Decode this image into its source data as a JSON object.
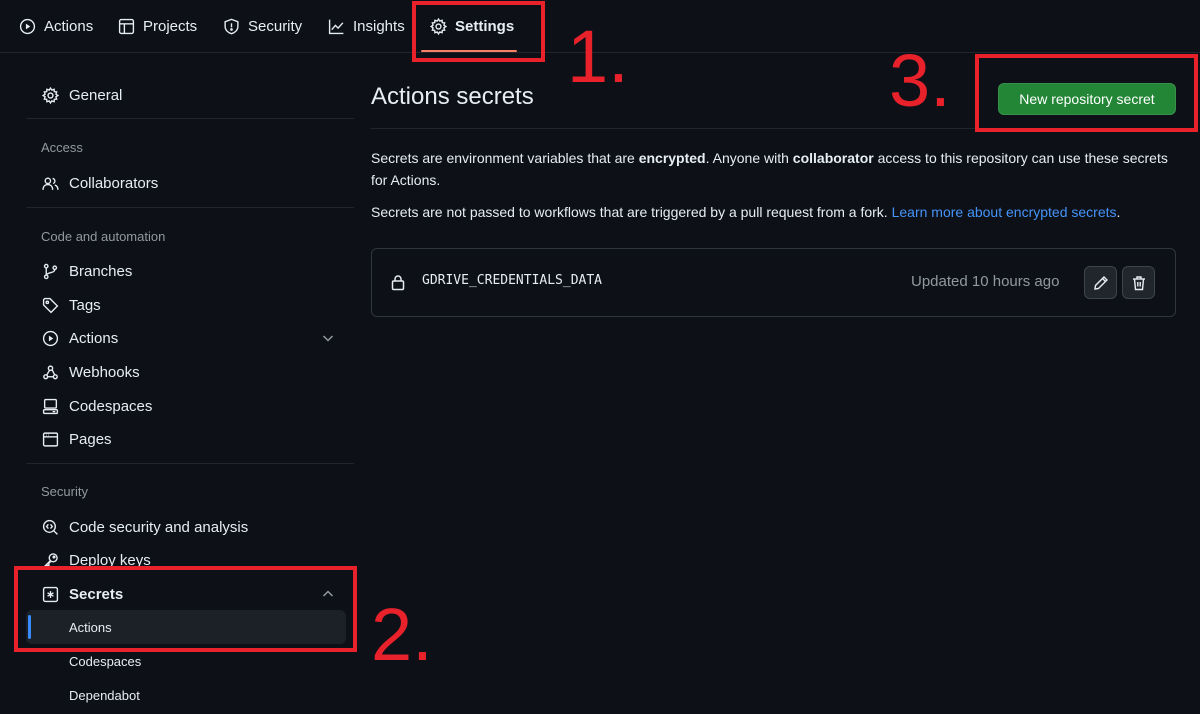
{
  "topnav": {
    "tabs": [
      {
        "label": "Actions",
        "icon": "play-icon"
      },
      {
        "label": "Projects",
        "icon": "table-icon"
      },
      {
        "label": "Security",
        "icon": "shield-icon"
      },
      {
        "label": "Insights",
        "icon": "graph-icon"
      },
      {
        "label": "Settings",
        "icon": "gear-icon",
        "selected": true
      }
    ]
  },
  "sidebar": {
    "general": "General",
    "access_heading": "Access",
    "collaborators": "Collaborators",
    "code_heading": "Code and automation",
    "branches": "Branches",
    "tags": "Tags",
    "actions": "Actions",
    "webhooks": "Webhooks",
    "codespaces": "Codespaces",
    "pages": "Pages",
    "security_heading": "Security",
    "code_security": "Code security and analysis",
    "deploy_keys": "Deploy keys",
    "secrets": "Secrets",
    "secrets_sub": [
      "Actions",
      "Codespaces",
      "Dependabot"
    ],
    "active_sub": "Actions"
  },
  "main": {
    "title": "Actions secrets",
    "new_secret_button": "New repository secret",
    "desc1": {
      "part1": "Secrets are environment variables that are ",
      "bold1": "encrypted",
      "part2": ". Anyone with ",
      "bold2": "collaborator",
      "part3": " access to this repository can use these secrets for Actions."
    },
    "desc2": {
      "text": "Secrets are not passed to workflows that are triggered by a pull request from a fork. ",
      "link": "Learn more about encrypted secrets",
      "end": "."
    },
    "secrets": [
      {
        "name": "GDRIVE_CREDENTIALS_DATA",
        "updated": "Updated 10 hours ago"
      }
    ]
  },
  "annotations": {
    "step1": "1.",
    "step2": "2.",
    "step3": "3.",
    "color": "#e8212b"
  },
  "colors": {
    "background": "#0d1117",
    "primary_button": "#238636",
    "link": "#4493f8",
    "active_indicator": "#388bfd",
    "tab_underline": "#f78166"
  }
}
